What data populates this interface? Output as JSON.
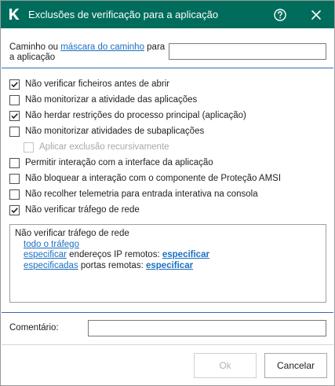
{
  "window": {
    "title": "Exclusões de verificação para a aplicação",
    "help_icon": "help-circle-icon",
    "close_icon": "close-icon",
    "logo_icon": "kaspersky-k-logo-icon"
  },
  "path": {
    "label_before": "Caminho ou ",
    "label_link": "máscara do caminho",
    "label_after": " para a aplicação",
    "value": "",
    "placeholder": ""
  },
  "options": [
    {
      "label": "Não verificar ficheiros antes de abrir",
      "checked": true,
      "disabled": false
    },
    {
      "label": "Não monitorizar a atividade das aplicações",
      "checked": false,
      "disabled": false
    },
    {
      "label": "Não herdar restrições do processo principal (aplicação)",
      "checked": true,
      "disabled": false
    },
    {
      "label": "Não monitorizar atividades de subaplicações",
      "checked": false,
      "disabled": false
    },
    {
      "label": "Aplicar exclusão recursivamente",
      "checked": false,
      "disabled": true
    },
    {
      "label": "Permitir interação com a interface da aplicação",
      "checked": false,
      "disabled": false
    },
    {
      "label": "Não bloquear a interação com o componente de Proteção AMSI",
      "checked": false,
      "disabled": false
    },
    {
      "label": "Não recolher telemetria para entrada interativa na consola",
      "checked": false,
      "disabled": false
    },
    {
      "label": "Não verificar tráfego de rede",
      "checked": true,
      "disabled": false
    }
  ],
  "details": {
    "heading": "Não verificar tráfego de rede",
    "line1_link": "todo o tráfego",
    "line2_link": "especificar",
    "line2_text": " endereços IP remotos: ",
    "line2_value": "especificar",
    "line3_link": "especificadas",
    "line3_text": " portas remotas: ",
    "line3_value": "especificar"
  },
  "comment": {
    "label": "Comentário:",
    "value": ""
  },
  "buttons": {
    "ok": "Ok",
    "cancel": "Cancelar"
  },
  "colors": {
    "titlebar": "#006d5c",
    "link": "#1a6fc2",
    "separator": "#2f6db5"
  }
}
